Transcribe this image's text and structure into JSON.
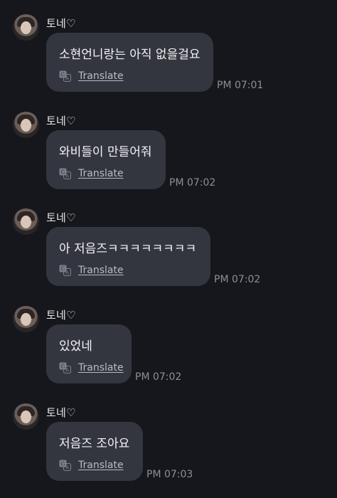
{
  "messages": [
    {
      "sender": "토네♡",
      "text": "소현언니랑는 아직 없을걸요",
      "translate_label": "Translate",
      "time": "PM 07:01"
    },
    {
      "sender": "토네♡",
      "text": "와비들이 만들어줘",
      "translate_label": "Translate",
      "time": "PM 07:02"
    },
    {
      "sender": "토네♡",
      "text": "아 저음즈ㅋㅋㅋㅋㅋㅋㅋㅋ",
      "translate_label": "Translate",
      "time": "PM 07:02"
    },
    {
      "sender": "토네♡",
      "text": "있었네",
      "translate_label": "Translate",
      "time": "PM 07:02"
    },
    {
      "sender": "토네♡",
      "text": "저음즈 조아요",
      "translate_label": "Translate",
      "time": "PM 07:03"
    }
  ]
}
